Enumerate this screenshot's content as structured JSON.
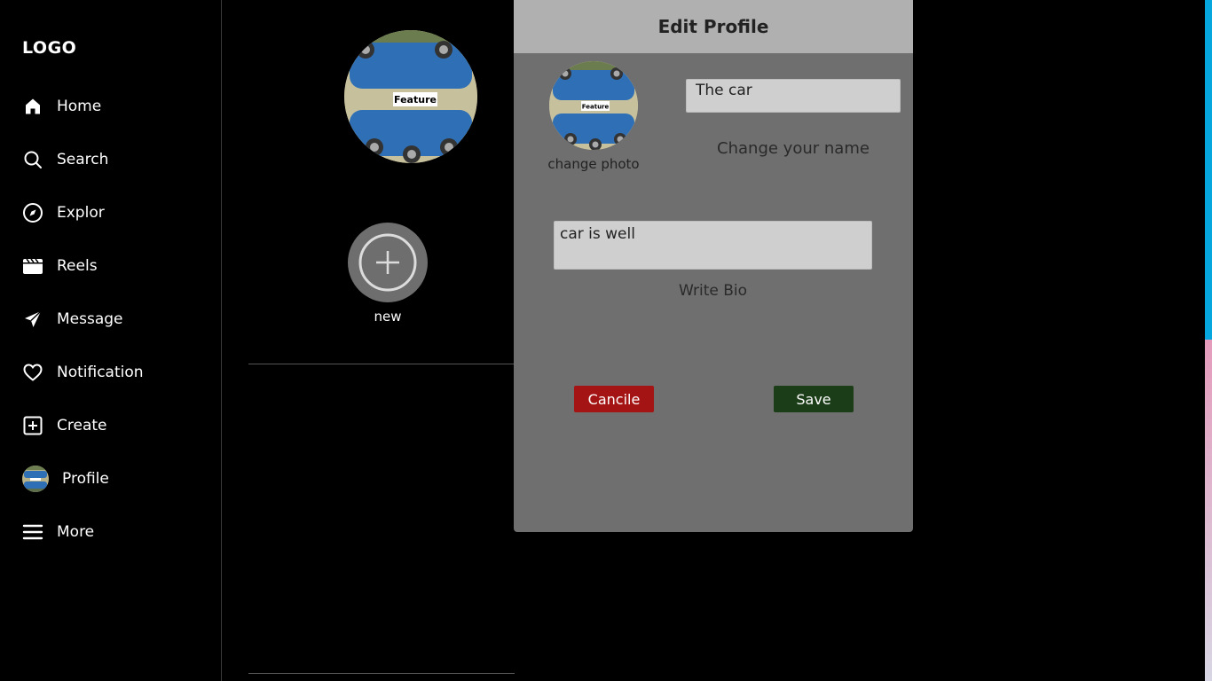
{
  "sidebar": {
    "logo": "LOGO",
    "items": [
      {
        "label": "Home",
        "icon": "home-icon"
      },
      {
        "label": "Search",
        "icon": "search-icon"
      },
      {
        "label": "Explor",
        "icon": "compass-icon"
      },
      {
        "label": "Reels",
        "icon": "clapperboard-icon"
      },
      {
        "label": "Message",
        "icon": "send-icon"
      },
      {
        "label": "Notification",
        "icon": "heart-icon"
      },
      {
        "label": "Create",
        "icon": "plus-square-icon"
      },
      {
        "label": "Profile",
        "icon": "avatar"
      },
      {
        "label": "More",
        "icon": "menu-icon"
      }
    ]
  },
  "main": {
    "new_label": "new"
  },
  "modal": {
    "title": "Edit Profile",
    "change_photo": "change photo",
    "name_value": "The car",
    "name_caption": "Change your name",
    "bio_value": "car is well",
    "bio_caption": "Write Bio",
    "cancel_label": "Cancile",
    "save_label": "Save",
    "photo_badge": "Feature"
  },
  "colors": {
    "background": "#000000",
    "modal_bg": "#6f6f6f",
    "modal_header": "#b0b0b0",
    "cancel": "#a51414",
    "save": "#1b3d17"
  }
}
